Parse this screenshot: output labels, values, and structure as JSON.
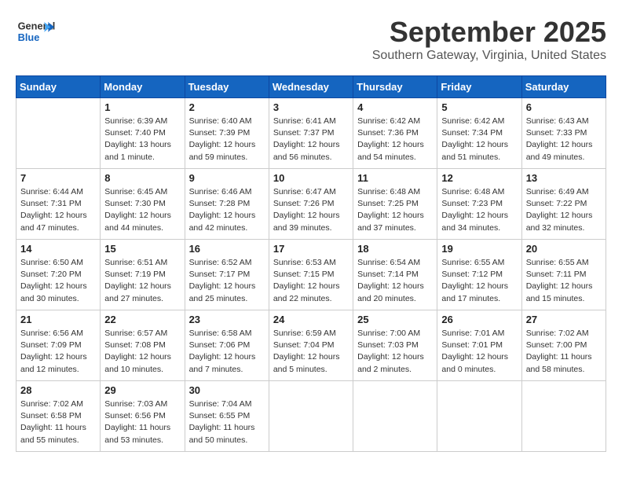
{
  "header": {
    "logo_line1": "General",
    "logo_line2": "Blue",
    "month": "September 2025",
    "location": "Southern Gateway, Virginia, United States"
  },
  "weekdays": [
    "Sunday",
    "Monday",
    "Tuesday",
    "Wednesday",
    "Thursday",
    "Friday",
    "Saturday"
  ],
  "weeks": [
    [
      {
        "day": "",
        "info": ""
      },
      {
        "day": "1",
        "info": "Sunrise: 6:39 AM\nSunset: 7:40 PM\nDaylight: 13 hours\nand 1 minute."
      },
      {
        "day": "2",
        "info": "Sunrise: 6:40 AM\nSunset: 7:39 PM\nDaylight: 12 hours\nand 59 minutes."
      },
      {
        "day": "3",
        "info": "Sunrise: 6:41 AM\nSunset: 7:37 PM\nDaylight: 12 hours\nand 56 minutes."
      },
      {
        "day": "4",
        "info": "Sunrise: 6:42 AM\nSunset: 7:36 PM\nDaylight: 12 hours\nand 54 minutes."
      },
      {
        "day": "5",
        "info": "Sunrise: 6:42 AM\nSunset: 7:34 PM\nDaylight: 12 hours\nand 51 minutes."
      },
      {
        "day": "6",
        "info": "Sunrise: 6:43 AM\nSunset: 7:33 PM\nDaylight: 12 hours\nand 49 minutes."
      }
    ],
    [
      {
        "day": "7",
        "info": "Sunrise: 6:44 AM\nSunset: 7:31 PM\nDaylight: 12 hours\nand 47 minutes."
      },
      {
        "day": "8",
        "info": "Sunrise: 6:45 AM\nSunset: 7:30 PM\nDaylight: 12 hours\nand 44 minutes."
      },
      {
        "day": "9",
        "info": "Sunrise: 6:46 AM\nSunset: 7:28 PM\nDaylight: 12 hours\nand 42 minutes."
      },
      {
        "day": "10",
        "info": "Sunrise: 6:47 AM\nSunset: 7:26 PM\nDaylight: 12 hours\nand 39 minutes."
      },
      {
        "day": "11",
        "info": "Sunrise: 6:48 AM\nSunset: 7:25 PM\nDaylight: 12 hours\nand 37 minutes."
      },
      {
        "day": "12",
        "info": "Sunrise: 6:48 AM\nSunset: 7:23 PM\nDaylight: 12 hours\nand 34 minutes."
      },
      {
        "day": "13",
        "info": "Sunrise: 6:49 AM\nSunset: 7:22 PM\nDaylight: 12 hours\nand 32 minutes."
      }
    ],
    [
      {
        "day": "14",
        "info": "Sunrise: 6:50 AM\nSunset: 7:20 PM\nDaylight: 12 hours\nand 30 minutes."
      },
      {
        "day": "15",
        "info": "Sunrise: 6:51 AM\nSunset: 7:19 PM\nDaylight: 12 hours\nand 27 minutes."
      },
      {
        "day": "16",
        "info": "Sunrise: 6:52 AM\nSunset: 7:17 PM\nDaylight: 12 hours\nand 25 minutes."
      },
      {
        "day": "17",
        "info": "Sunrise: 6:53 AM\nSunset: 7:15 PM\nDaylight: 12 hours\nand 22 minutes."
      },
      {
        "day": "18",
        "info": "Sunrise: 6:54 AM\nSunset: 7:14 PM\nDaylight: 12 hours\nand 20 minutes."
      },
      {
        "day": "19",
        "info": "Sunrise: 6:55 AM\nSunset: 7:12 PM\nDaylight: 12 hours\nand 17 minutes."
      },
      {
        "day": "20",
        "info": "Sunrise: 6:55 AM\nSunset: 7:11 PM\nDaylight: 12 hours\nand 15 minutes."
      }
    ],
    [
      {
        "day": "21",
        "info": "Sunrise: 6:56 AM\nSunset: 7:09 PM\nDaylight: 12 hours\nand 12 minutes."
      },
      {
        "day": "22",
        "info": "Sunrise: 6:57 AM\nSunset: 7:08 PM\nDaylight: 12 hours\nand 10 minutes."
      },
      {
        "day": "23",
        "info": "Sunrise: 6:58 AM\nSunset: 7:06 PM\nDaylight: 12 hours\nand 7 minutes."
      },
      {
        "day": "24",
        "info": "Sunrise: 6:59 AM\nSunset: 7:04 PM\nDaylight: 12 hours\nand 5 minutes."
      },
      {
        "day": "25",
        "info": "Sunrise: 7:00 AM\nSunset: 7:03 PM\nDaylight: 12 hours\nand 2 minutes."
      },
      {
        "day": "26",
        "info": "Sunrise: 7:01 AM\nSunset: 7:01 PM\nDaylight: 12 hours\nand 0 minutes."
      },
      {
        "day": "27",
        "info": "Sunrise: 7:02 AM\nSunset: 7:00 PM\nDaylight: 11 hours\nand 58 minutes."
      }
    ],
    [
      {
        "day": "28",
        "info": "Sunrise: 7:02 AM\nSunset: 6:58 PM\nDaylight: 11 hours\nand 55 minutes."
      },
      {
        "day": "29",
        "info": "Sunrise: 7:03 AM\nSunset: 6:56 PM\nDaylight: 11 hours\nand 53 minutes."
      },
      {
        "day": "30",
        "info": "Sunrise: 7:04 AM\nSunset: 6:55 PM\nDaylight: 11 hours\nand 50 minutes."
      },
      {
        "day": "",
        "info": ""
      },
      {
        "day": "",
        "info": ""
      },
      {
        "day": "",
        "info": ""
      },
      {
        "day": "",
        "info": ""
      }
    ]
  ]
}
